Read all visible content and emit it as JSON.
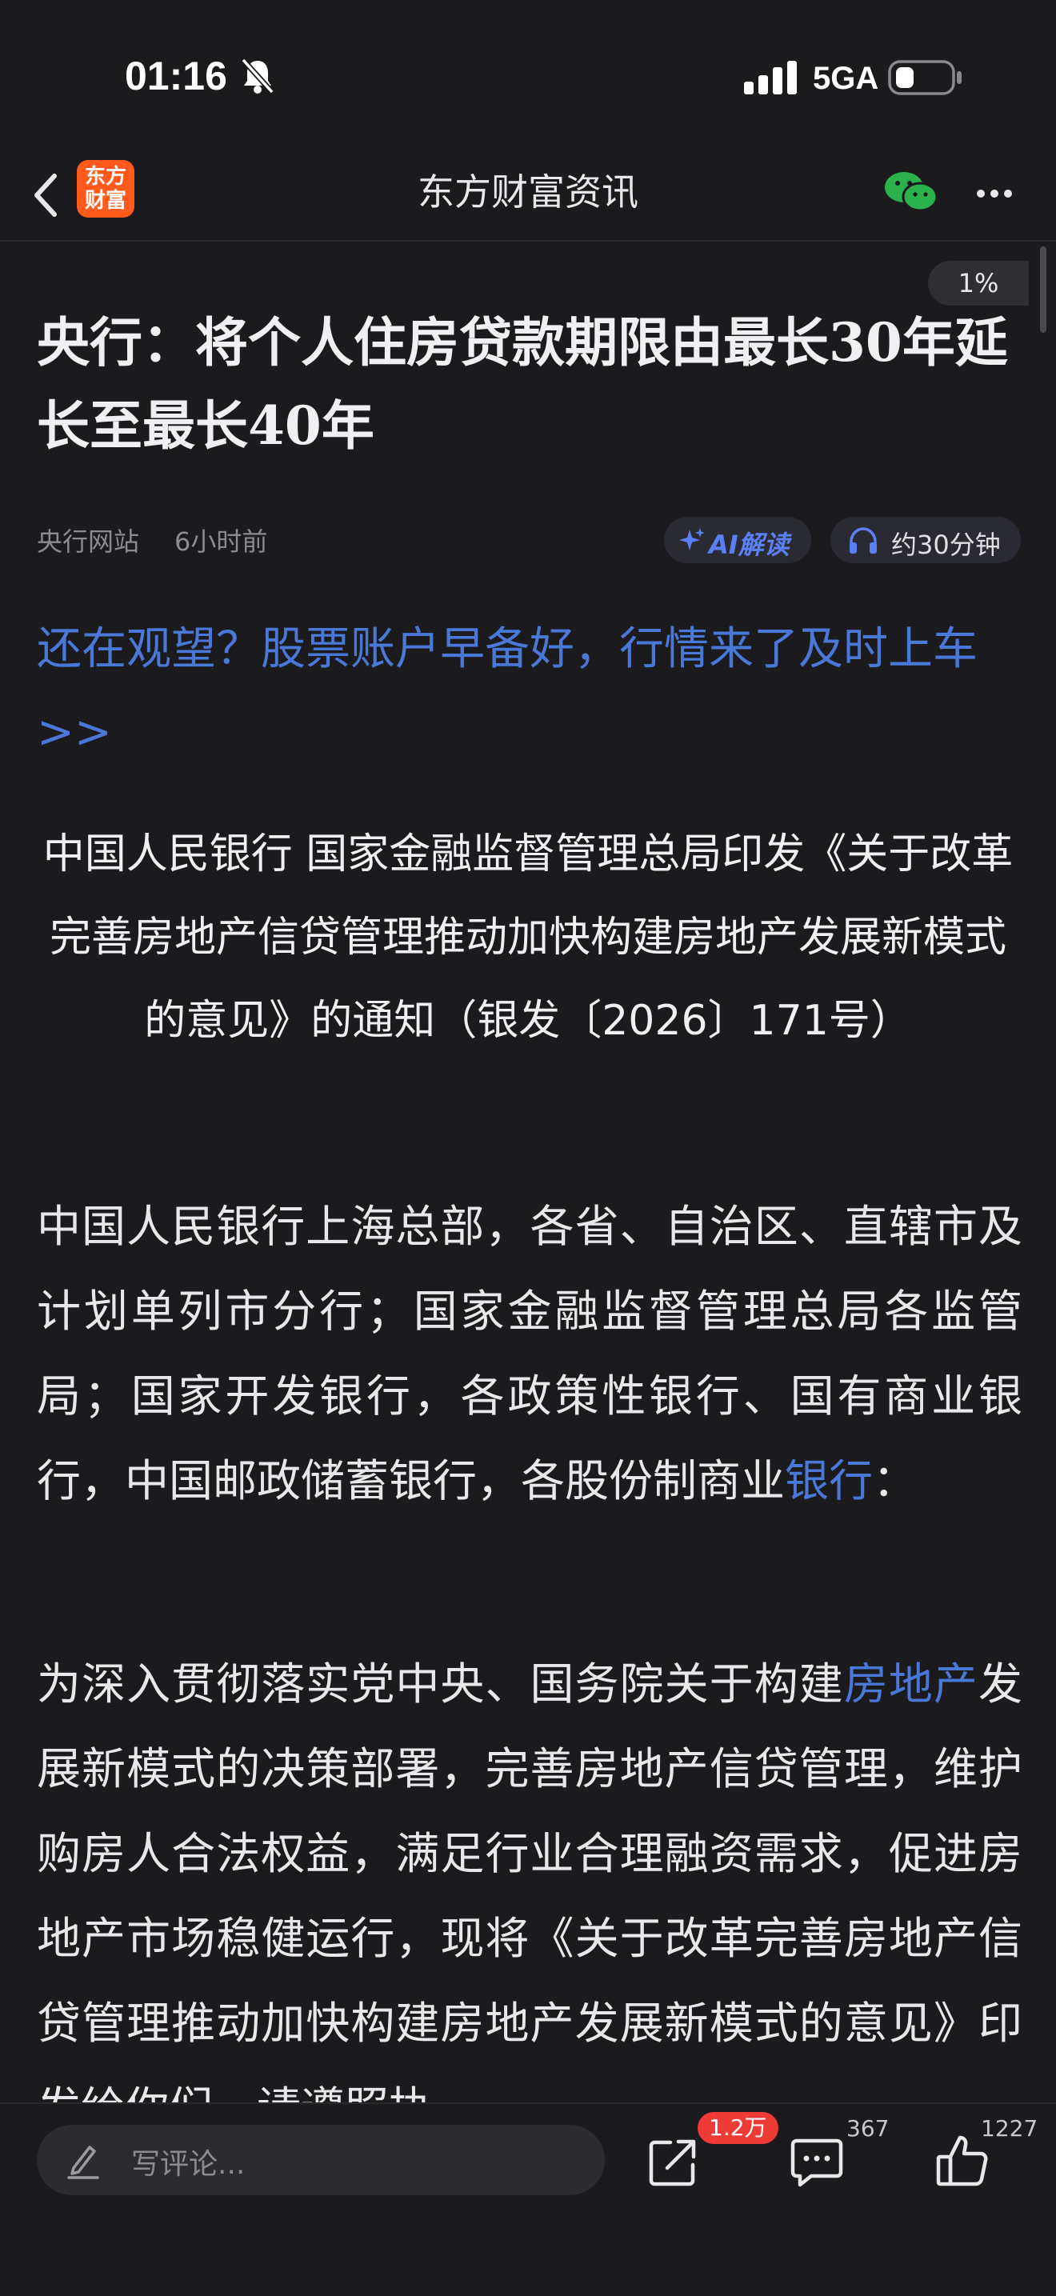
{
  "status": {
    "time": "01:16",
    "network": "5GA"
  },
  "nav": {
    "title": "东方财富资讯",
    "logo_line1": "东方",
    "logo_line2": "财富"
  },
  "reading_progress": "1%",
  "article": {
    "title": "央行：将个人住房贷款期限由最长30年延长至最长40年",
    "source": "央行网站",
    "time": "6小时前",
    "ai_label": "AI解读",
    "listen_label": "约30分钟",
    "promo_link": "还在观望？股票账户早备好，行情来了及时上车>>",
    "notice_title": "中国人民银行 国家金融监督管理总局印发《关于改革完善房地产信贷管理推动加快构建房地产发展新模式的意见》的通知（银发〔2026〕171号）",
    "para1_before": "中国人民银行上海总部，各省、自治区、直辖市及计划单列市分行；国家金融监督管理总局各监管局；国家开发银行，各政策性银行、国有商业银行，中国邮政储蓄银行，各股份制商业",
    "para1_link": "银行",
    "para1_after": "：",
    "para2_before": "为深入贯彻落实党中央、国务院关于构建",
    "para2_link": "房地产",
    "para2_after": "发展新模式的决策部署，完善房地产信贷管理，维护购房人合法权益，满足行业合理融资需求，促进房地产市场稳健运行，现将《关于改革完善房地产信贷管理推动加快构建房地产发展新模式的意见》印发给你们，请遵照执"
  },
  "bottom": {
    "comment_placeholder": "写评论...",
    "share_count": "1.2万",
    "comment_count": "367",
    "like_count": "1227"
  },
  "colors": {
    "background": "#1b1b1d",
    "link": "#4a78d8",
    "badge": "#ef3b36",
    "logo": "#ff5a1c"
  },
  "icons": [
    "bell-off-icon",
    "signal-icon",
    "battery-icon",
    "back-icon",
    "wechat-icon",
    "more-icon",
    "ai-star-icon",
    "headphone-icon",
    "pencil-icon",
    "share-icon",
    "comment-icon",
    "like-icon"
  ]
}
